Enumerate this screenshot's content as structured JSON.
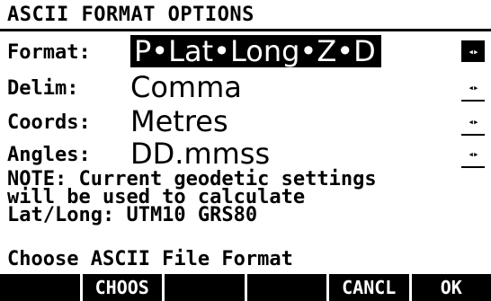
{
  "title": "ASCII FORMAT OPTIONS",
  "fields": [
    {
      "label": "Format:",
      "value": "P•Lat•Long•Z•D",
      "selected": true
    },
    {
      "label": "Delim:",
      "value": "Comma"
    },
    {
      "label": "Coords:",
      "value": "Metres"
    },
    {
      "label": "Angles:",
      "value": "DD.mmss"
    }
  ],
  "arrows_glyph": "◂▸",
  "note": "NOTE: Current geodetic settings\nwill be used to calculate\nLat/Long: UTM10 GRS80",
  "hint": "Choose ASCII File Format",
  "softkeys": [
    "",
    "CHOOS",
    "",
    "",
    "CANCL",
    "OK"
  ]
}
